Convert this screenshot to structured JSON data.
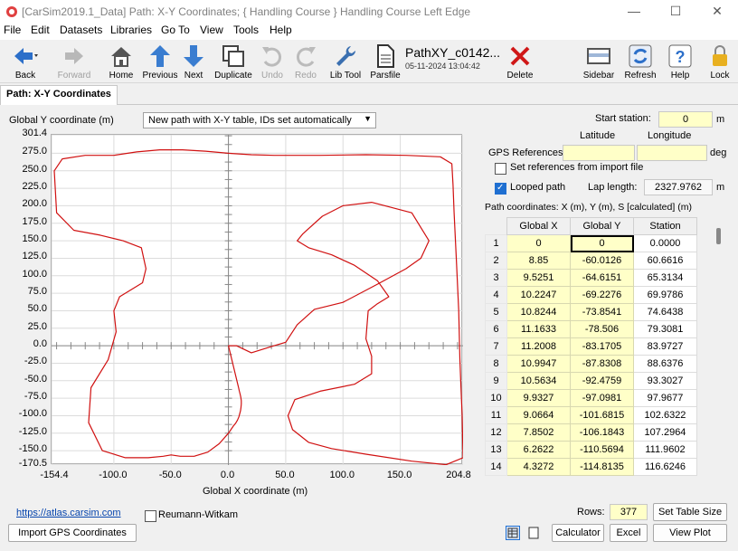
{
  "window": {
    "title": "[CarSim2019.1_Data] Path: X-Y Coordinates; { Handling Course } Handling Course Left Edge",
    "minimize": "—",
    "maximize": "☐",
    "close": "✕"
  },
  "menu": [
    "File",
    "Edit",
    "Datasets",
    "Libraries",
    "Go To",
    "View",
    "Tools",
    "Help"
  ],
  "toolbar": {
    "back": "Back",
    "forward": "Forward",
    "home": "Home",
    "previous": "Previous",
    "next": "Next",
    "duplicate": "Duplicate",
    "undo": "Undo",
    "redo": "Redo",
    "lib_tool": "Lib Tool",
    "parsfile": "Parsfile",
    "dataset_name": "PathXY_c0142...",
    "dataset_date": "05-11-2024 13:04:42",
    "delete": "Delete",
    "sidebar": "Sidebar",
    "refresh": "Refresh",
    "help": "Help",
    "lock": "Lock"
  },
  "tab": "Path: X-Y Coordinates",
  "plot": {
    "ylabel": "Global Y coordinate (m)",
    "xlabel": "Global X coordinate (m)",
    "mode": "New path with X-Y table, IDs set automatically",
    "yticks": [
      "301.4",
      "275.0",
      "250.0",
      "225.0",
      "200.0",
      "175.0",
      "150.0",
      "125.0",
      "100.0",
      "75.0",
      "50.0",
      "25.0",
      "0.0",
      "-25.0",
      "-50.0",
      "-75.0",
      "-100.0",
      "-125.0",
      "-150.0",
      "-170.5"
    ],
    "xticks": [
      "-154.4",
      "-100.0",
      "-50.0",
      "0.0",
      "50.0",
      "100.0",
      "150.0",
      "204.8"
    ]
  },
  "chart_data": {
    "type": "line",
    "xlabel": "Global X coordinate (m)",
    "ylabel": "Global Y coordinate (m)",
    "xlim": [
      -154.4,
      204.8
    ],
    "ylim": [
      -170.5,
      301.4
    ],
    "grid": true,
    "series": [
      {
        "x": [
          0,
          8.85,
          9.5,
          10.2,
          10.8,
          11.2,
          11.2,
          11.0,
          10.6,
          9.9,
          9.1,
          7.9,
          6.3,
          4.3,
          0,
          -8,
          -18,
          -30,
          -42,
          -50,
          -57,
          -70,
          -90,
          -110,
          -122,
          -120,
          -105,
          -98,
          -100,
          -95,
          -85,
          -75,
          -72,
          -76,
          -92,
          -112,
          -135,
          -150,
          -152,
          -145,
          -125,
          -100,
          -80,
          -60,
          -40,
          -20,
          0,
          20,
          40,
          80,
          120,
          155,
          185,
          195,
          196,
          197,
          199,
          201,
          202,
          203,
          204,
          204.8,
          190,
          160,
          120,
          90,
          70,
          56,
          52,
          58,
          80,
          110,
          125,
          125,
          120,
          122,
          130,
          140,
          130,
          110,
          90,
          70,
          60,
          65,
          82,
          100,
          125,
          160,
          175,
          168,
          155,
          130,
          100,
          75,
          60,
          50,
          40,
          20,
          7,
          0
        ],
        "y": [
          0,
          -60.0,
          -64.6,
          -69.2,
          -73.9,
          -78.5,
          -83.2,
          -87.8,
          -92.5,
          -97.1,
          -101.7,
          -106.2,
          -110.6,
          -114.8,
          -125,
          -140,
          -152,
          -158,
          -158,
          -156,
          -158,
          -160,
          -160,
          -150,
          -110,
          -60,
          -20,
          20,
          50,
          70,
          80,
          90,
          110,
          140,
          150,
          158,
          165,
          190,
          250,
          267,
          272,
          272,
          277,
          280,
          280,
          278,
          275,
          273,
          272,
          272,
          273,
          272,
          270,
          260,
          230,
          190,
          120,
          50,
          -20,
          -60,
          -100,
          -160,
          -170,
          -165,
          -155,
          -147,
          -138,
          -120,
          -100,
          -77,
          -65,
          -55,
          -40,
          -15,
          10,
          50,
          60,
          70,
          93,
          115,
          130,
          140,
          150,
          160,
          185,
          200,
          205,
          190,
          150,
          125,
          110,
          88,
          62,
          52,
          30,
          5,
          0,
          -10,
          0,
          0
        ]
      }
    ]
  },
  "right": {
    "start_station_label": "Start station:",
    "start_station_value": "0",
    "unit_m": "m",
    "latitude": "Latitude",
    "longitude": "Longitude",
    "gps_refs": "GPS References",
    "unit_deg": "deg",
    "set_refs_label": "Set references from import file",
    "looped_label": "Looped path",
    "lap_length_label": "Lap length:",
    "lap_length_value": "2327.9762",
    "table_caption": "Path coordinates: X (m), Y (m), S [calculated] (m)",
    "columns": [
      "Global X",
      "Global Y",
      "Station"
    ],
    "rows": [
      [
        "1",
        "0",
        "0",
        "0.0000"
      ],
      [
        "2",
        "8.85",
        "-60.0126",
        "60.6616"
      ],
      [
        "3",
        "9.5251",
        "-64.6151",
        "65.3134"
      ],
      [
        "4",
        "10.2247",
        "-69.2276",
        "69.9786"
      ],
      [
        "5",
        "10.8244",
        "-73.8541",
        "74.6438"
      ],
      [
        "6",
        "11.1633",
        "-78.506",
        "79.3081"
      ],
      [
        "7",
        "11.2008",
        "-83.1705",
        "83.9727"
      ],
      [
        "8",
        "10.9947",
        "-87.8308",
        "88.6376"
      ],
      [
        "9",
        "10.5634",
        "-92.4759",
        "93.3027"
      ],
      [
        "10",
        "9.9327",
        "-97.0981",
        "97.9677"
      ],
      [
        "11",
        "9.0664",
        "-101.6815",
        "102.6322"
      ],
      [
        "12",
        "7.8502",
        "-106.1843",
        "107.2964"
      ],
      [
        "13",
        "6.2622",
        "-110.5694",
        "111.9602"
      ],
      [
        "14",
        "4.3272",
        "-114.8135",
        "116.6246"
      ]
    ],
    "rows_label": "Rows:",
    "rows_value": "377",
    "set_table_size": "Set Table Size"
  },
  "bottom": {
    "link": "https://atlas.carsim.com",
    "reumann": "Reumann-Witkam",
    "import_gps": "Import GPS Coordinates",
    "calculator": "Calculator",
    "excel": "Excel",
    "view_plot": "View Plot"
  }
}
